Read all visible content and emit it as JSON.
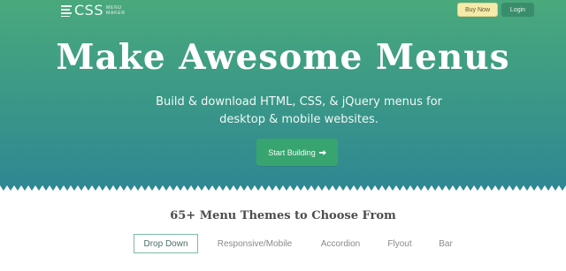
{
  "header": {
    "logo": {
      "main": "CSS",
      "line1": "MENU",
      "line2": "MAKER"
    },
    "buy_label": "Buy Now",
    "login_label": "Login"
  },
  "hero": {
    "title": "Make Awesome Menus",
    "subtitle": "Build & download HTML, CSS, & jQuery menus for desktop & mobile websites.",
    "cta_label": "Start Building"
  },
  "themes": {
    "title": "65+ Menu Themes to Choose From",
    "tabs": [
      {
        "label": "Drop Down",
        "active": true
      },
      {
        "label": "Responsive/Mobile",
        "active": false
      },
      {
        "label": "Accordion",
        "active": false
      },
      {
        "label": "Flyout",
        "active": false
      },
      {
        "label": "Bar",
        "active": false
      }
    ]
  },
  "colors": {
    "hero_top": "#4aa97c",
    "hero_bottom": "#2f8793",
    "cta": "#38a46f",
    "buy": "#f6eaa8"
  }
}
